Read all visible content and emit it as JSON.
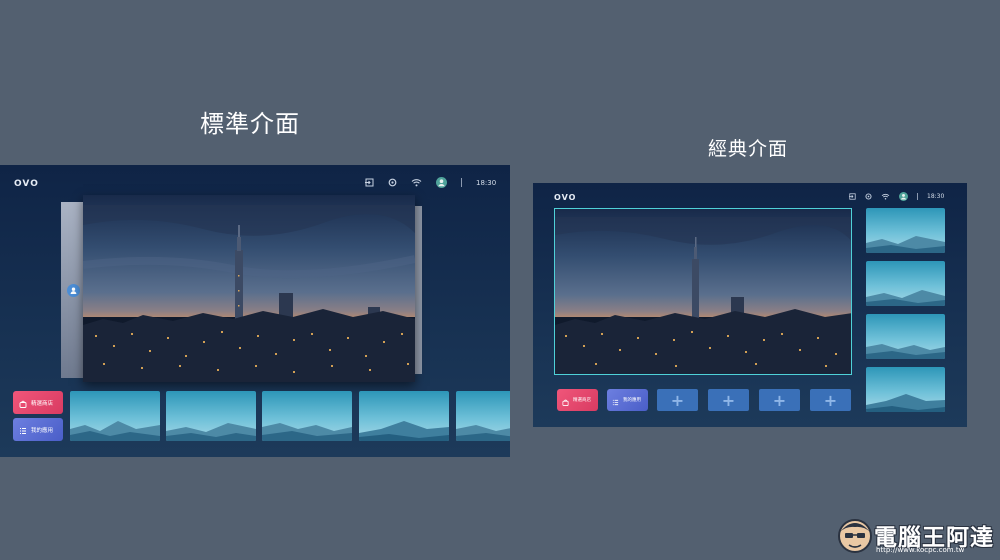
{
  "captions": {
    "standard": "標準介面",
    "classic": "經典介面"
  },
  "standard": {
    "logo": "OVO",
    "clock": "18:30",
    "icons": [
      "input-icon",
      "settings-icon",
      "wifi-icon",
      "avatar-icon"
    ],
    "apps": [
      {
        "label": "精選商店",
        "icon": "bag-icon",
        "color": "#e94a70"
      },
      {
        "label": "我的應用",
        "icon": "list-icon",
        "color": "#5b6fd8"
      }
    ]
  },
  "classic": {
    "logo": "OVO",
    "clock": "18:30",
    "icons": [
      "input-icon",
      "settings-icon",
      "wifi-icon",
      "avatar-icon"
    ],
    "apps": [
      {
        "label": "精選商店",
        "icon": "bag-icon",
        "color": "#e94a70"
      },
      {
        "label": "我的應用",
        "icon": "list-icon",
        "color": "#5b6fd8"
      }
    ],
    "add_tiles": [
      "+",
      "+",
      "+",
      "+"
    ]
  },
  "watermark": {
    "text": "電腦王阿達",
    "url": "http://www.kocpc.com.tw"
  }
}
